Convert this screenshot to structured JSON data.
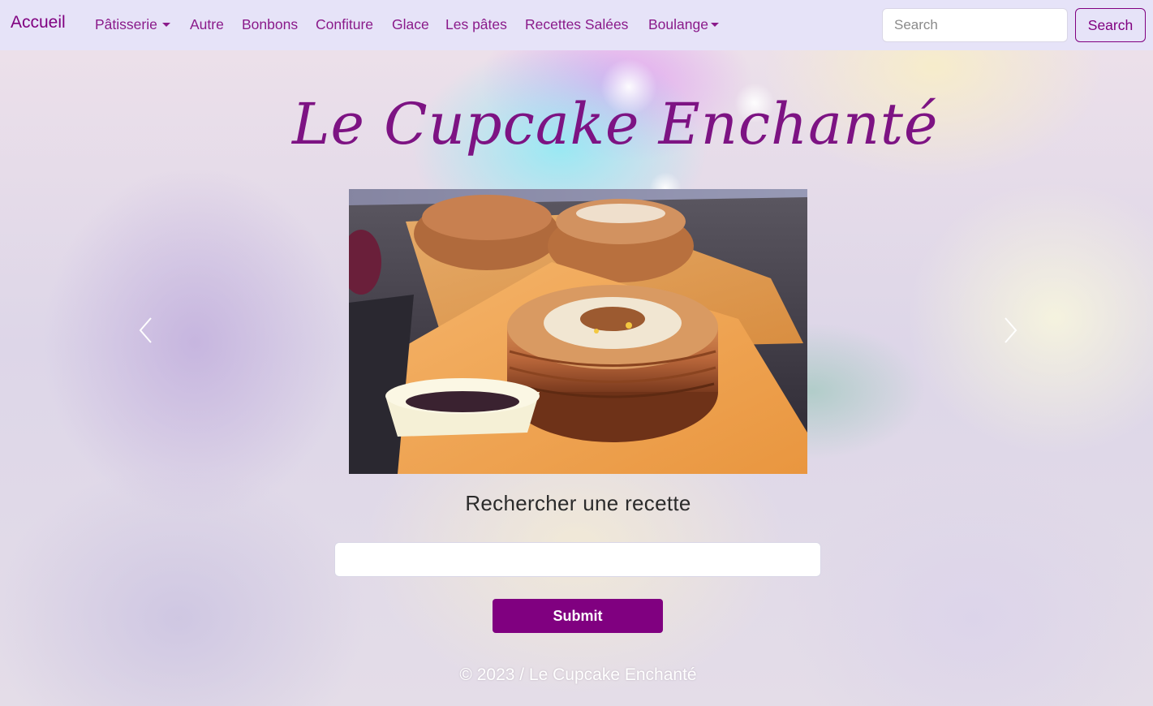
{
  "navbar": {
    "brand": "Accueil",
    "items": [
      {
        "label": "Pâtisserie",
        "dropdown": true
      },
      {
        "label": "Autre",
        "dropdown": false
      },
      {
        "label": "Bonbons",
        "dropdown": false
      },
      {
        "label": "Confiture",
        "dropdown": false
      },
      {
        "label": "Glace",
        "dropdown": false
      },
      {
        "label": "Les pâtes",
        "dropdown": false
      },
      {
        "label": "Recettes Salées",
        "dropdown": false
      },
      {
        "label": "Boulange",
        "dropdown": true
      }
    ],
    "search": {
      "placeholder": "Search",
      "value": "",
      "button_label": "Search"
    }
  },
  "hero": {
    "title": "Le Cupcake Enchanté"
  },
  "carousel": {
    "prev_icon": "chevron-left-icon",
    "next_icon": "chevron-right-icon",
    "slide_image": "cronut-pastry-photo"
  },
  "recipe_search": {
    "heading": "Rechercher une recette",
    "input_value": "",
    "submit_label": "Submit"
  },
  "footer": {
    "text": "© 2023 / Le Cupcake Enchanté"
  },
  "colors": {
    "accent": "#800080",
    "navbar_bg": "#e6e3f8",
    "nav_text": "#8a1a8a"
  }
}
